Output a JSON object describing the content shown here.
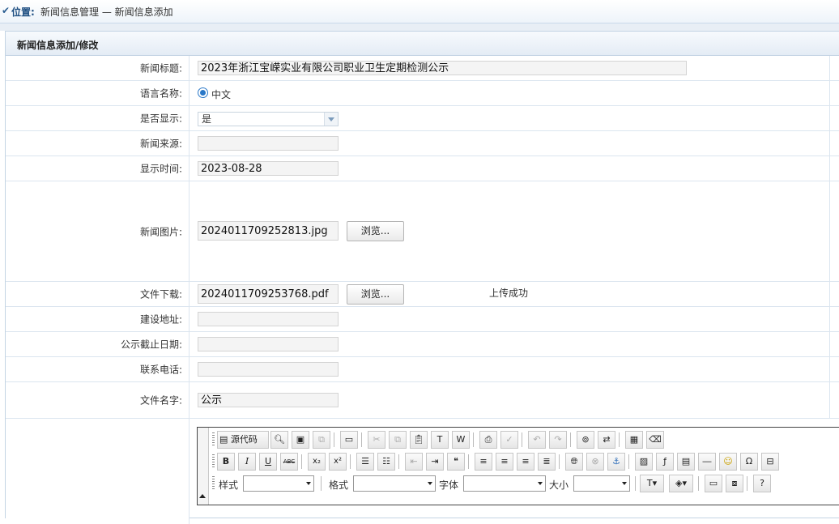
{
  "location": {
    "label": "位置:",
    "path": "新闻信息管理 — 新闻信息添加"
  },
  "panel": {
    "title": "新闻信息添加/修改"
  },
  "form": {
    "title": {
      "label": "新闻标题:",
      "value": "2023年浙江宝嵘实业有限公司职业卫生定期检测公示"
    },
    "language": {
      "label": "语言名称:",
      "option": "中文"
    },
    "show": {
      "label": "是否显示:",
      "value": "是"
    },
    "source": {
      "label": "新闻来源:",
      "value": ""
    },
    "date": {
      "label": "显示时间:",
      "value": "2023-08-28"
    },
    "image": {
      "label": "新闻图片:",
      "value": "202401170925281​3.jpg",
      "browse": "浏览..."
    },
    "file": {
      "label": "文件下载:",
      "value": "202401170925376​8.pdf",
      "browse": "浏览...",
      "status": "上传成功"
    },
    "address": {
      "label": "建设地址:",
      "value": ""
    },
    "deadline": {
      "label": "公示截止日期:",
      "value": ""
    },
    "phone": {
      "label": "联系电话:",
      "value": ""
    },
    "filename": {
      "label": "文件名字:",
      "value": "公示"
    }
  },
  "editor": {
    "source_label": "源代码",
    "style_label": "样式",
    "format_label": "格式",
    "font_label": "字体",
    "size_label": "大小",
    "bold": "B",
    "italic": "I",
    "underline": "U",
    "strike": "ABC",
    "sub": "x₂",
    "sup": "x²",
    "blockquote": "❝"
  }
}
